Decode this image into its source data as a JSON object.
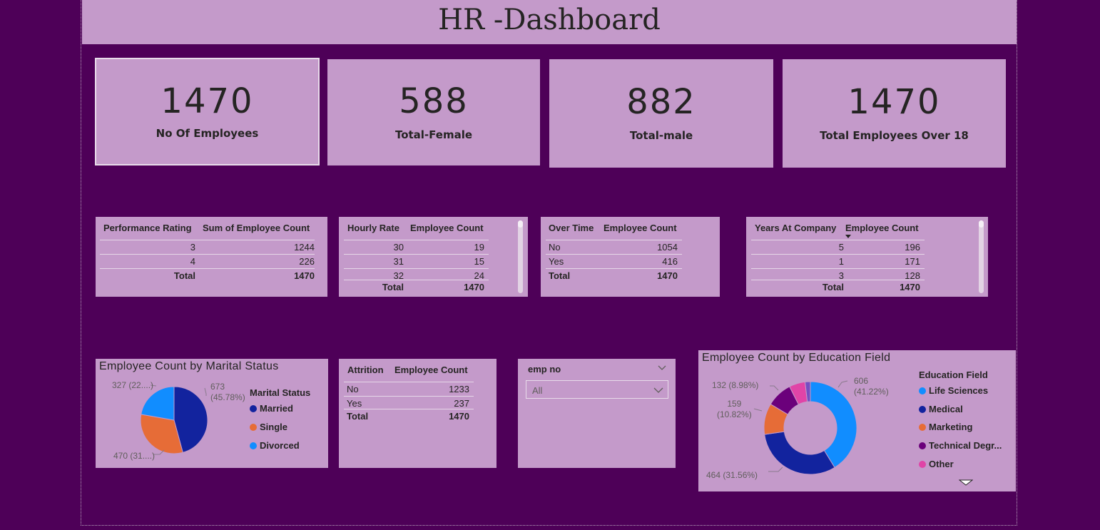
{
  "header": {
    "title": "HR -Dashboard"
  },
  "cards": [
    {
      "value": "1470",
      "label": "No Of Employees"
    },
    {
      "value": "588",
      "label": "Total-Female"
    },
    {
      "value": "882",
      "label": "Total-male"
    },
    {
      "value": "1470",
      "label": "Total Employees Over 18"
    }
  ],
  "performance_table": {
    "headers": [
      "Performance Rating",
      "Sum of Employee Count"
    ],
    "rows": [
      [
        "3",
        "1244"
      ],
      [
        "4",
        "226"
      ]
    ],
    "total": [
      "Total",
      "1470"
    ]
  },
  "hourly_table": {
    "headers": [
      "Hourly Rate",
      "Employee Count"
    ],
    "rows": [
      [
        "30",
        "19"
      ],
      [
        "31",
        "15"
      ],
      [
        "32",
        "24"
      ]
    ],
    "total": [
      "Total",
      "1470"
    ]
  },
  "overtime_table": {
    "headers": [
      "Over Time",
      "Employee Count"
    ],
    "rows": [
      [
        "No",
        "1054"
      ],
      [
        "Yes",
        "416"
      ]
    ],
    "total": [
      "Total",
      "1470"
    ]
  },
  "years_table": {
    "headers": [
      "Years At Company",
      "Employee Count"
    ],
    "rows": [
      [
        "5",
        "196"
      ],
      [
        "1",
        "171"
      ],
      [
        "3",
        "128"
      ]
    ],
    "total": [
      "Total",
      "1470"
    ]
  },
  "attrition_table": {
    "headers": [
      "Attrition",
      "Employee Count"
    ],
    "rows": [
      [
        "No",
        "1233"
      ],
      [
        "Yes",
        "237"
      ]
    ],
    "total": [
      "Total",
      "1470"
    ]
  },
  "slicer": {
    "title": "emp no",
    "value": "All"
  },
  "marital_chart": {
    "legend_title": "Marital Status",
    "data_labels": {
      "married": [
        "673",
        "(45.78%)"
      ],
      "single": "470 (31....)",
      "divorced": "327 (22....)"
    }
  },
  "education_chart": {
    "legend_title": "Education Field",
    "data_labels": {
      "life": [
        "606",
        "(41.22%)"
      ],
      "medical": "464 (31.56%)",
      "marketing": [
        "159",
        "(10.82%)"
      ],
      "technical": "132 (8.98%)"
    }
  },
  "chart_data": [
    {
      "type": "pie",
      "title": "Employee Count by Marital Status",
      "legend": "right",
      "categories": [
        "Married",
        "Single",
        "Divorced"
      ],
      "values": [
        673,
        470,
        327
      ],
      "colors": [
        "#12239e",
        "#e66c37",
        "#118dff"
      ]
    },
    {
      "type": "pie",
      "subtype": "donut",
      "title": "Employee Count by Education Field",
      "legend": "right",
      "categories": [
        "Life Sciences",
        "Medical",
        "Marketing",
        "Technical Degr...",
        "Other"
      ],
      "values": [
        606,
        464,
        159,
        132,
        82,
        27
      ],
      "colors": [
        "#118dff",
        "#12239e",
        "#e66c37",
        "#6b007b",
        "#e044a7",
        "#744ec2"
      ]
    }
  ]
}
